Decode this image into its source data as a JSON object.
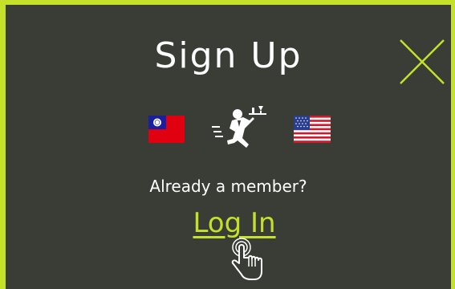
{
  "modal": {
    "title": "Sign Up",
    "prompt": "Already a member?",
    "login_label": "Log In",
    "icons": {
      "close": "close-icon",
      "left_flag": "taiwan-flag-icon",
      "center": "running-waiter-icon",
      "right_flag": "usa-flag-icon",
      "cursor": "hand-pointer-icon"
    },
    "colors": {
      "accent": "#c5e02a",
      "background": "#3a3d35",
      "text": "#ffffff"
    }
  }
}
